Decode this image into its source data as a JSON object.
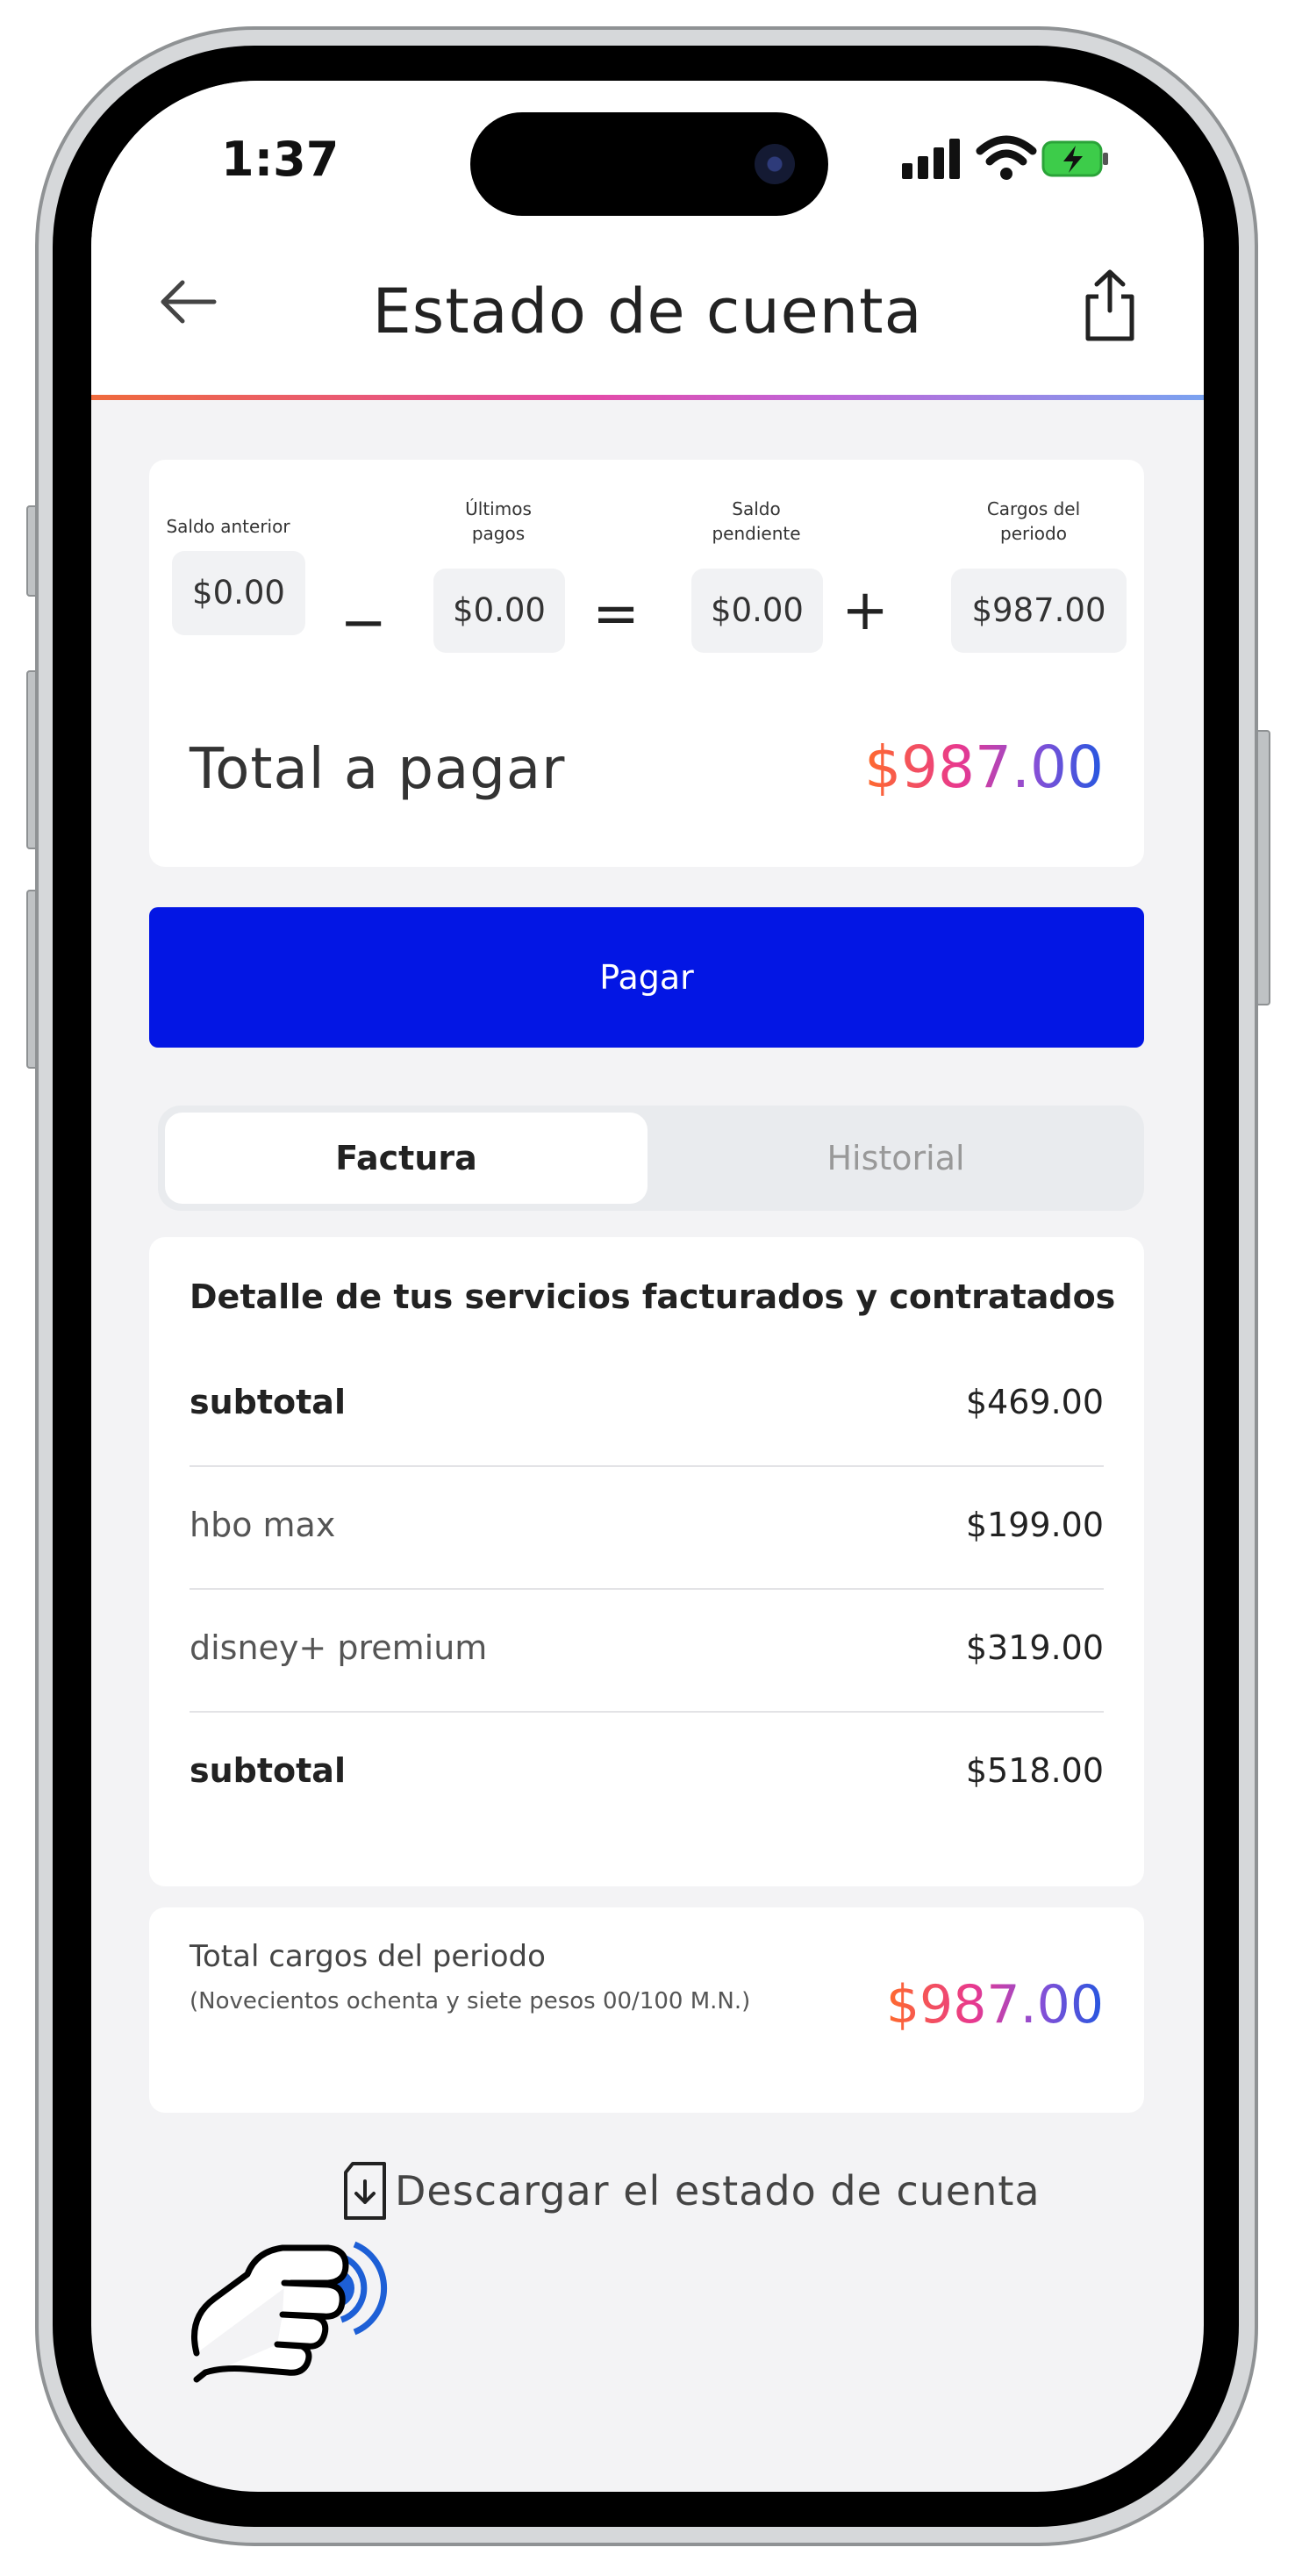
{
  "status_bar": {
    "time": "1:37"
  },
  "header": {
    "title": "Estado de cuenta"
  },
  "summary": {
    "items": [
      {
        "label_line1": "Saldo anterior",
        "label_line2": "",
        "value": "$0.00"
      },
      {
        "label_line1": "Últimos",
        "label_line2": "pagos",
        "value": "$0.00"
      },
      {
        "label_line1": "Saldo",
        "label_line2": "pendiente",
        "value": "$0.00"
      },
      {
        "label_line1": "Cargos del",
        "label_line2": "periodo",
        "value": "$987.00"
      }
    ],
    "operators": [
      "−",
      "=",
      "+"
    ],
    "total_label": "Total a pagar",
    "total_value": "$987.00"
  },
  "pay_button": {
    "label": "Pagar"
  },
  "tabs": [
    {
      "label": "Factura",
      "active": true
    },
    {
      "label": "Historial",
      "active": false
    }
  ],
  "detail": {
    "heading": "Detalle de tus servicios facturados y contratados",
    "rows": [
      {
        "label": "subtotal",
        "amount": "$469.00"
      },
      {
        "label": "hbo max",
        "amount": "$199.00"
      },
      {
        "label": "disney+ premium",
        "amount": "$319.00"
      },
      {
        "label": "subtotal",
        "amount": "$518.00"
      }
    ]
  },
  "period_total": {
    "title": "Total cargos del periodo",
    "subtitle": "(Novecientos ochenta y siete pesos 00/100 M.N.)",
    "amount": "$987.00"
  },
  "download": {
    "label": "Descargar el estado de cuenta"
  },
  "colors": {
    "primary": "#0316e4",
    "gradient_start": "#ff6b2b",
    "gradient_end": "#2457e0",
    "background": "#f3f3f5"
  },
  "icons": [
    "back-arrow-icon",
    "share-icon",
    "signal-icon",
    "wifi-icon",
    "battery-charging-icon",
    "download-document-icon",
    "pointing-hand-icon"
  ]
}
